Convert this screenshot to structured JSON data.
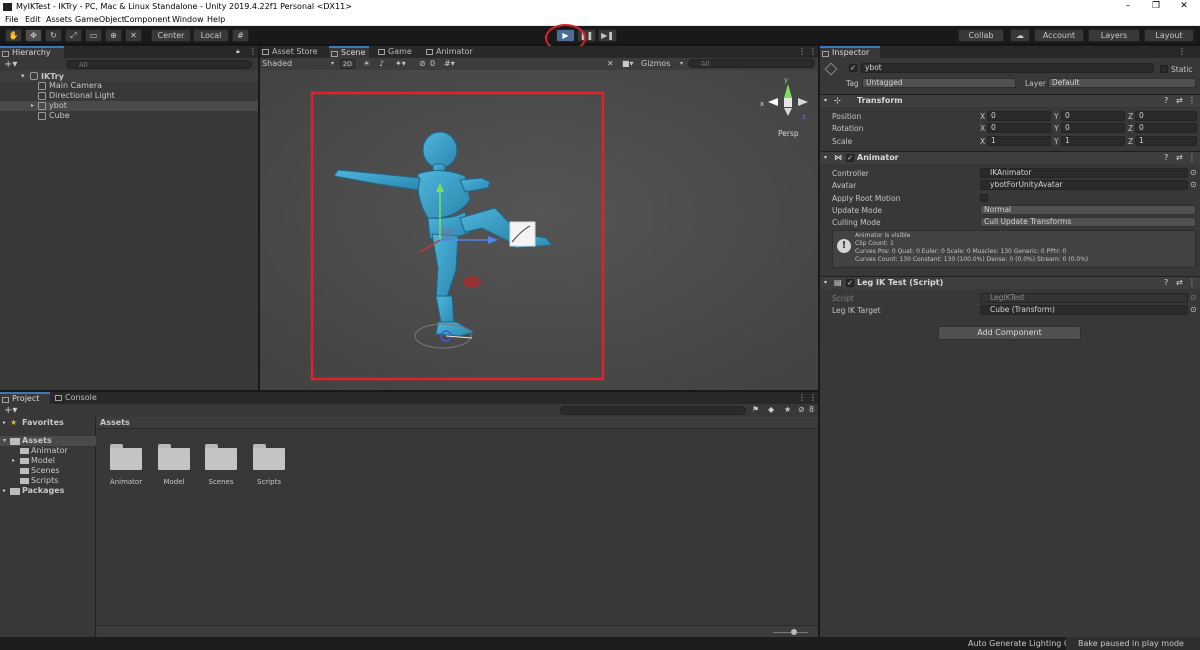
{
  "window": {
    "title": "MyIKTest - IKTry - PC, Mac & Linux Standalone - Unity 2019.4.22f1 Personal <DX11>",
    "minimize": "–",
    "maximize": "❐",
    "close": "✕"
  },
  "menu": [
    "File",
    "Edit",
    "Assets",
    "GameObject",
    "Component",
    "Window",
    "Help"
  ],
  "toolbar": {
    "pivot": "Center",
    "space": "Local",
    "collab": "Collab",
    "account": "Account",
    "layers": "Layers",
    "layout": "Layout"
  },
  "hierarchy": {
    "tab": "Hierarchy",
    "search_placeholder": "All",
    "scene": "IKTry",
    "items": [
      "Main Camera",
      "Directional Light",
      "ybot",
      "Cube"
    ]
  },
  "scene_tabs": [
    "Asset Store",
    "Scene",
    "Game",
    "Animator"
  ],
  "scene_toolbar": {
    "shading": "Shaded",
    "mode2d": "2D",
    "hidden_count": "0",
    "gizmos": "Gizmos",
    "search_placeholder": "All"
  },
  "scene_view": {
    "persp": "Persp",
    "axis_y": "y",
    "axis_x": "x",
    "axis_z": "z"
  },
  "inspector": {
    "tab": "Inspector",
    "object_name": "ybot",
    "static_label": "Static",
    "tag_label": "Tag",
    "tag_value": "Untagged",
    "layer_label": "Layer",
    "layer_value": "Default",
    "transform": {
      "title": "Transform",
      "rows": [
        {
          "label": "Position",
          "x": "0",
          "y": "0",
          "z": "0"
        },
        {
          "label": "Rotation",
          "x": "0",
          "y": "0",
          "z": "0"
        },
        {
          "label": "Scale",
          "x": "1",
          "y": "1",
          "z": "1"
        }
      ]
    },
    "animator": {
      "title": "Animator",
      "controller_label": "Controller",
      "controller_value": "IKAnimator",
      "avatar_label": "Avatar",
      "avatar_value": "ybotForUnityAvatar",
      "root_motion_label": "Apply Root Motion",
      "update_label": "Update Mode",
      "update_value": "Normal",
      "culling_label": "Culling Mode",
      "culling_value": "Cull Update Transforms",
      "info": [
        "Animator is visible",
        "Clip Count: 1",
        "Curves Pos: 0 Quat: 0 Euler: 0 Scale: 0 Muscles: 130 Generic: 0 PPtr: 0",
        "Curves Count: 130 Constant: 130 (100.0%) Dense: 0 (0.0%) Stream: 0 (0.0%)"
      ]
    },
    "legik": {
      "title": "Leg IK Test (Script)",
      "script_label": "Script",
      "script_value": "LegIKTest",
      "target_label": "Leg IK Target",
      "target_value": "Cube (Transform)"
    },
    "add_component": "Add Component"
  },
  "project": {
    "tabs": [
      "Project",
      "Console"
    ],
    "favorites": "Favorites",
    "assets_root": "Assets",
    "folders": [
      "Animator",
      "Model",
      "Scenes",
      "Scripts"
    ],
    "packages": "Packages",
    "breadcrumb": "Assets",
    "grid": [
      "Animator",
      "Model",
      "Scenes",
      "Scripts"
    ],
    "hidden_count": "8"
  },
  "statusbar": {
    "lighting": "Auto Generate Lighting Off",
    "bake": "Bake paused in play mode"
  },
  "colors": {
    "highlight_red": "#e0202a",
    "play_blue": "#4a6c96",
    "character": "#3aa0c8"
  }
}
